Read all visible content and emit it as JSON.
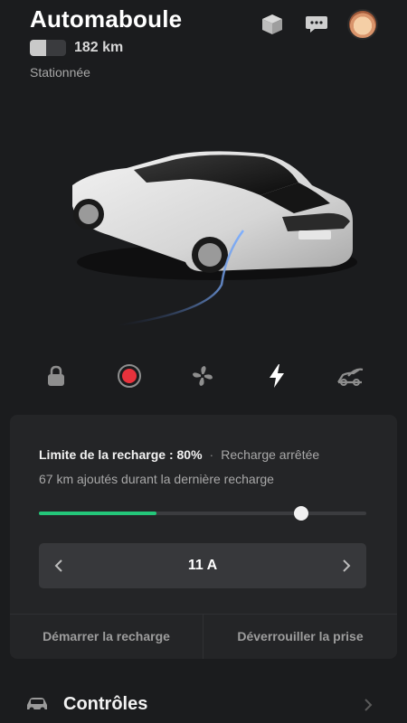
{
  "header": {
    "title": "Automaboule",
    "range": "182 km",
    "status": "Stationnée",
    "battery_level": 0.45,
    "icons": [
      "box-3d-icon",
      "chat-bubble-icon",
      "profile-avatar"
    ]
  },
  "quick_actions": [
    "lock-icon",
    "record-icon",
    "fan-icon",
    "lightning-icon",
    "trunk-icon"
  ],
  "charging": {
    "limit_label": "Limite de la recharge : 80%",
    "separator": "·",
    "state": "Recharge arrêtée",
    "added": "67 km ajoutés durant la dernière recharge",
    "battery_fill": 0.36,
    "limit_fraction": 0.8,
    "amps": "11 A",
    "start_button": "Démarrer la recharge",
    "unlock_button": "Déverrouiller la prise"
  },
  "controls": {
    "label": "Contrôles"
  },
  "colors": {
    "background": "#1b1c1e",
    "card": "#242527",
    "accent_green": "#24c77a",
    "record_red": "#e8323c"
  }
}
